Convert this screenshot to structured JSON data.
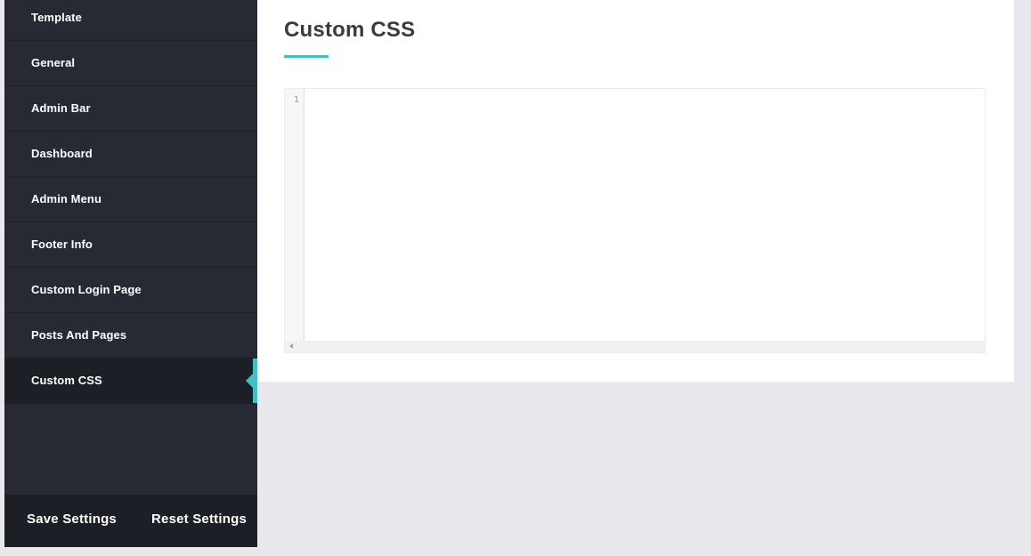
{
  "sidebar": {
    "items": [
      {
        "label": "Template"
      },
      {
        "label": "General"
      },
      {
        "label": "Admin Bar"
      },
      {
        "label": "Dashboard"
      },
      {
        "label": "Admin Menu"
      },
      {
        "label": "Footer Info"
      },
      {
        "label": "Custom Login Page"
      },
      {
        "label": "Posts And Pages"
      },
      {
        "label": "Custom CSS",
        "active": true
      }
    ],
    "footer": {
      "save_label": "Save Settings",
      "reset_label": "Reset Settings"
    }
  },
  "main": {
    "title": "Custom CSS",
    "editor": {
      "line_numbers": [
        "1"
      ],
      "content": ""
    }
  },
  "colors": {
    "accent": "#3fc2c6",
    "sidebar_bg": "#272a33",
    "sidebar_active_bg": "#1c1f26",
    "page_bg": "#e9e9ed"
  }
}
